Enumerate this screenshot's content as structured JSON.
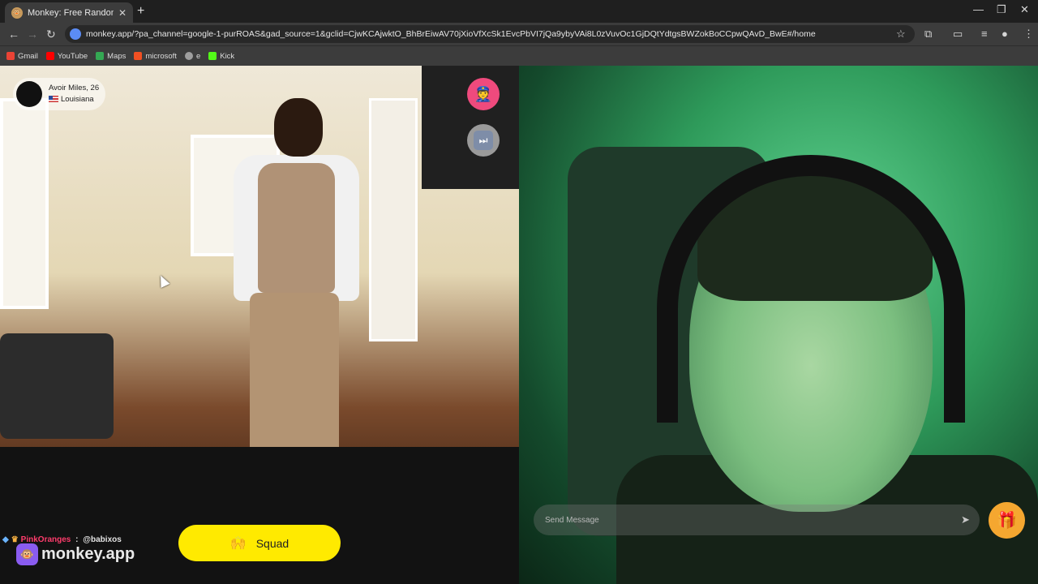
{
  "browser": {
    "tab_title": "Monkey: Free Random Vide",
    "tab_favicon": "monkey-icon",
    "url": "monkey.app/?pa_channel=google-1-purROAS&gad_source=1&gclid=CjwKCAjwktO_BhBrEiwAV70jXioVfXcSk1EvcPbVI7jQa9ybyVAi8L0zVuvOc1GjDQtYdtgsBWZokBoCCpwQAvD_BwE#/home",
    "bookmarks": [
      {
        "label": "Gmail",
        "color": "#ea4335"
      },
      {
        "label": "YouTube",
        "color": "#ff0000"
      },
      {
        "label": "Maps",
        "color": "#34a853"
      },
      {
        "label": "microsoft",
        "color": "#f25022"
      },
      {
        "label": "e",
        "color": "#9e9e9e"
      },
      {
        "label": "Kick",
        "color": "#53fc18"
      }
    ]
  },
  "remote_user": {
    "name_age": "Avoir Miles, 26",
    "location": "Louisiana"
  },
  "controls": {
    "squad_label": "Squad",
    "squad_emoji": "🙌",
    "report_emoji": "👮",
    "skip_emoji": "⏭",
    "gift_emoji": "🎁"
  },
  "credit": {
    "user": "PinkOranges",
    "separator": " : ",
    "handle": "@babixos"
  },
  "brand": {
    "name": "monkey.app",
    "logo": "🐵"
  },
  "chat": {
    "placeholder": "Send Message"
  },
  "colors": {
    "squad_yellow": "#ffea00",
    "report_pink": "#ef4a7d",
    "gift_orange": "#f5a730",
    "brand_purple": "#8a5cf0"
  }
}
